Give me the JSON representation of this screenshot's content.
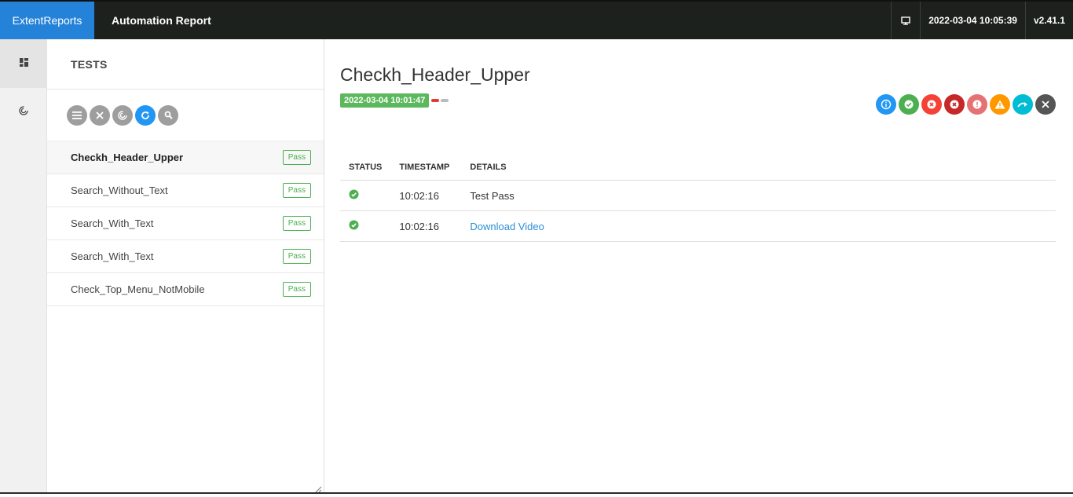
{
  "topbar": {
    "brand": "ExtentReports",
    "report_name": "Automation Report",
    "timestamp": "2022-03-04 10:05:39",
    "version": "v2.41.1",
    "brand_color": "#2582d9"
  },
  "rail": {
    "items": [
      "dashboard-icon",
      "spiral-icon"
    ]
  },
  "tests_panel": {
    "title": "TESTS",
    "tools": [
      "list-icon",
      "close-icon",
      "spiral-icon",
      "refresh-icon",
      "search-icon"
    ],
    "tests": [
      {
        "name": "Checkh_Header_Upper",
        "status": "Pass"
      },
      {
        "name": "Search_Without_Text",
        "status": "Pass"
      },
      {
        "name": "Search_With_Text",
        "status": "Pass"
      },
      {
        "name": "Search_With_Text",
        "status": "Pass"
      },
      {
        "name": "Check_Top_Menu_NotMobile",
        "status": "Pass"
      }
    ]
  },
  "detail": {
    "title": "Checkh_Header_Upper",
    "started": "2022-03-04 10:01:47",
    "status_filters": [
      {
        "icon": "info-icon",
        "color": "#2196f3"
      },
      {
        "icon": "check-icon",
        "color": "#4caf50"
      },
      {
        "icon": "fail-icon",
        "color": "#f44336"
      },
      {
        "icon": "fatal-icon",
        "color": "#c62828"
      },
      {
        "icon": "error-icon",
        "color": "#e57373"
      },
      {
        "icon": "warning-icon",
        "color": "#ff9800"
      },
      {
        "icon": "skip-icon",
        "color": "#00bcd4"
      },
      {
        "icon": "clear-icon",
        "color": "#555555"
      }
    ],
    "log_table": {
      "headers": [
        "STATUS",
        "TIMESTAMP",
        "DETAILS"
      ],
      "rows": [
        {
          "status": "pass",
          "timestamp": "10:02:16",
          "details": "Test Pass",
          "is_link": false
        },
        {
          "status": "pass",
          "timestamp": "10:02:16",
          "details": "Download Video",
          "is_link": true
        }
      ]
    }
  }
}
